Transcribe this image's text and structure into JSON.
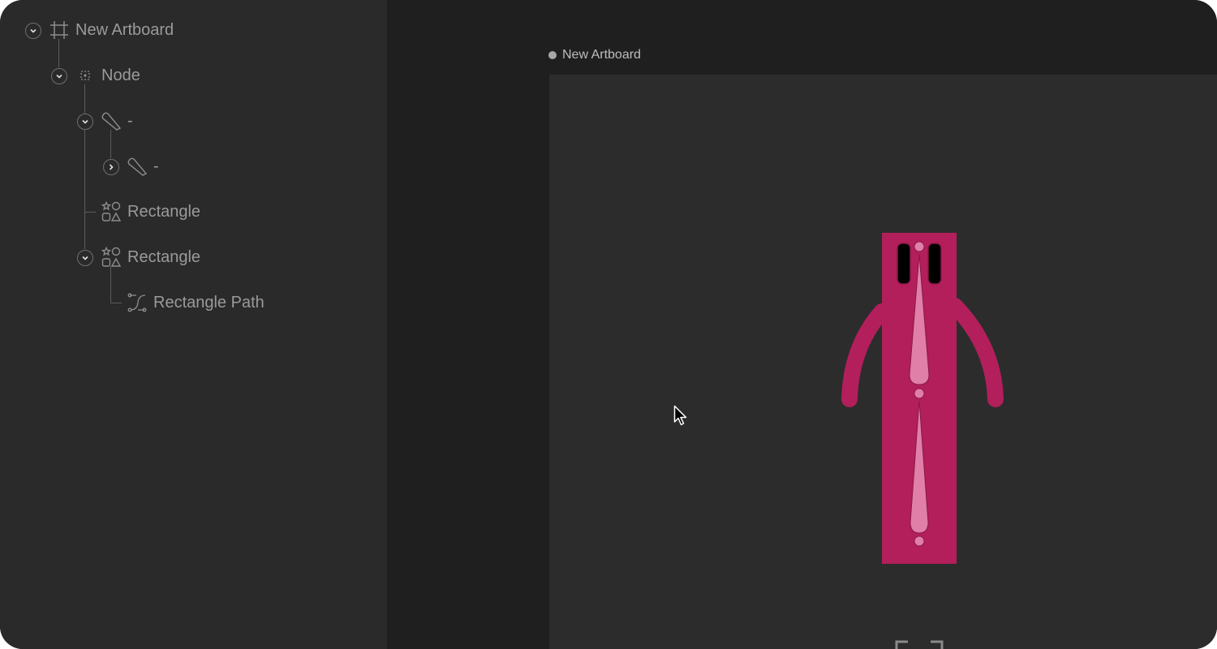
{
  "hierarchy": {
    "items": [
      {
        "label": "New Artboard",
        "icon": "artboard-icon",
        "expander": "expanded"
      },
      {
        "label": "Node",
        "icon": "node-icon",
        "expander": "expanded"
      },
      {
        "label": "-",
        "icon": "pen-shape-icon",
        "expander": "expanded"
      },
      {
        "label": "-",
        "icon": "pen-shape-icon",
        "expander": "collapsed"
      },
      {
        "label": "Rectangle",
        "icon": "shapes-icon",
        "expander": "none"
      },
      {
        "label": "Rectangle",
        "icon": "shapes-icon",
        "expander": "expanded"
      },
      {
        "label": "Rectangle Path",
        "icon": "path-icon",
        "expander": "none"
      }
    ]
  },
  "stage": {
    "artboard_title": "New Artboard"
  },
  "colors": {
    "panel_bg": "#2a2a2a",
    "stage_bg": "#1f1f1f",
    "artboard_bg": "#2c2c2c",
    "figure_magenta": "#b21f5b",
    "figure_pink": "#e07fa8",
    "figure_black": "#000000",
    "text_muted": "#9a9a9a"
  }
}
